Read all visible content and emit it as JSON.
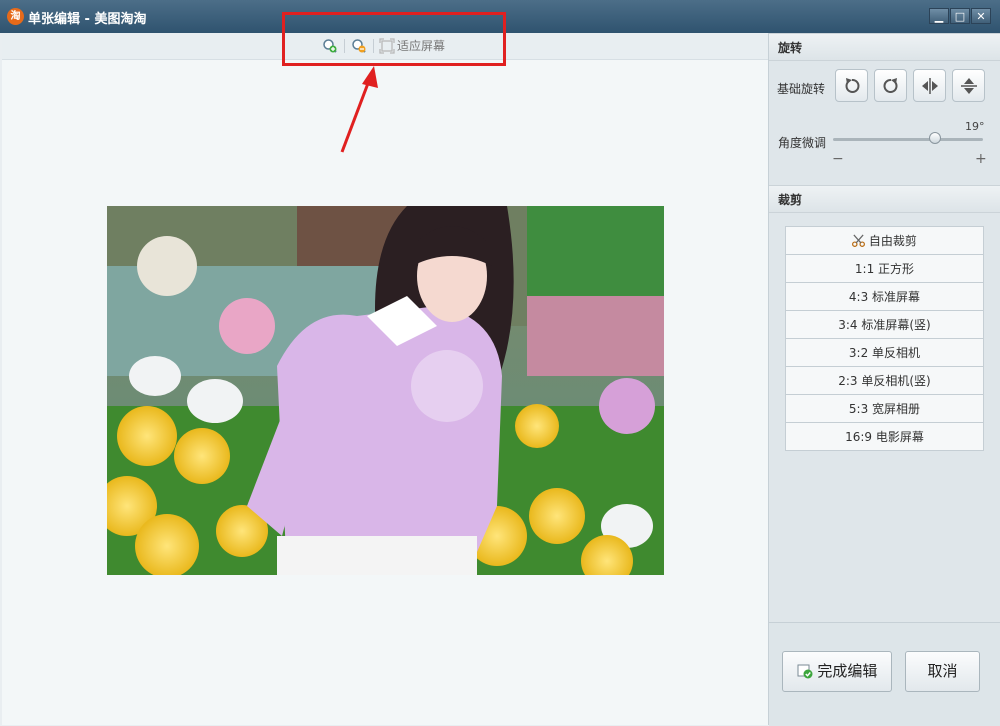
{
  "window": {
    "title": "单张编辑 - 美图淘淘",
    "app_icon_glyph": "淘"
  },
  "titlebar_buttons": {
    "minimize": "▁",
    "maximize": "□",
    "close": "✕"
  },
  "toolbar": {
    "fit_screen_label": "适应屏幕",
    "zoom_in_icon": "zoom-in-icon",
    "zoom_out_icon": "zoom-out-icon",
    "fit_icon": "fit-screen-icon"
  },
  "annotation": {
    "highlight_color": "#e02020"
  },
  "photo": {
    "description_icon": "photo-preview"
  },
  "rotate": {
    "section_title": "旋转",
    "basic_label": "基础旋转",
    "angle_label": "角度微调",
    "angle_value": "19°",
    "angle_fraction": 0.68,
    "minus": "−",
    "plus": "+"
  },
  "crop": {
    "section_title": "裁剪",
    "items": [
      {
        "label": "自由裁剪"
      },
      {
        "label": "1:1 正方形"
      },
      {
        "label": "4:3 标准屏幕"
      },
      {
        "label": "3:4 标准屏幕(竖)"
      },
      {
        "label": "3:2 单反相机"
      },
      {
        "label": "2:3 单反相机(竖)"
      },
      {
        "label": "5:3 宽屏相册"
      },
      {
        "label": "16:9 电影屏幕"
      }
    ]
  },
  "actions": {
    "done_label": "完成编辑",
    "cancel_label": "取消"
  },
  "colors": {
    "titlebar": "#3a5d78",
    "accent_red": "#e02020"
  }
}
